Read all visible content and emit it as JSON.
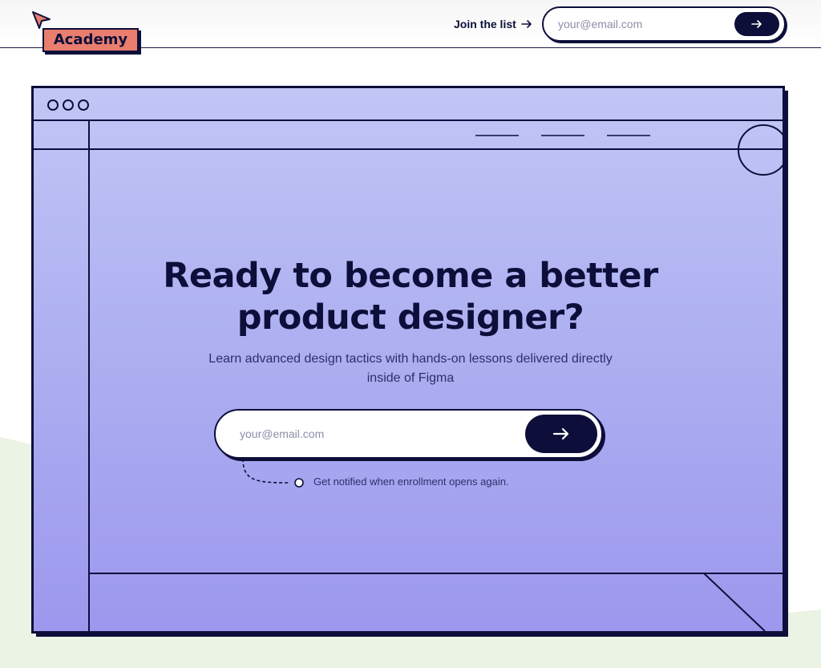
{
  "brand": {
    "name": "Academy",
    "icon": "paper-plane-icon",
    "tag_color": "#e97e6e"
  },
  "header": {
    "join_label": "Join the list",
    "email_placeholder": "your@email.com",
    "submit_icon": "arrow-right-icon"
  },
  "hero": {
    "title": "Ready to become a better product designer?",
    "subtitle": "Learn advanced design tactics with hands-on lessons delivered directly inside of Figma",
    "email_placeholder": "your@email.com",
    "submit_icon": "arrow-right-icon",
    "note": "Get notified when enrollment opens again."
  },
  "colors": {
    "ink": "#0d0f3a",
    "window_top": "#c2c6f5",
    "window_bottom": "#9c98ee",
    "accent": "#e97e6e",
    "background_shape": "#eaf3e4"
  }
}
